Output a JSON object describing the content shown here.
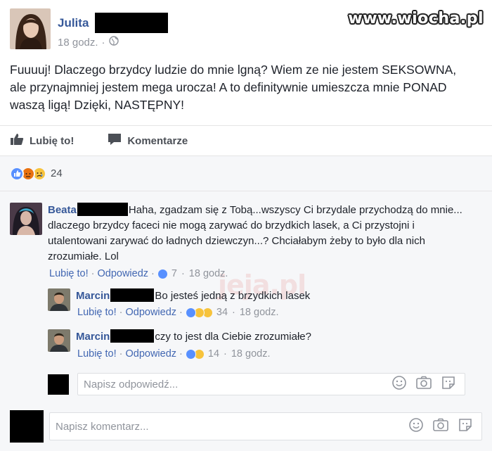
{
  "watermark": "www.wiocha.pl",
  "ghost_watermark": "jeja.pl",
  "post": {
    "author_name": "Julita",
    "time": "18 godz.",
    "separator": "·",
    "privacy_icon": "globe-icon",
    "text": "Fuuuuj! Dlaczego brzydcy ludzie do mnie lgną? Wiem ze nie jestem SEKSOWNA, ale przynajmniej jestem mega urocza! A to definitywnie umieszcza mnie PONAD waszą ligą! Dzięki, NASTĘPNY!"
  },
  "actions": {
    "like_label": "Lubię to!",
    "comment_label": "Komentarze"
  },
  "reactions": {
    "icons": [
      "like-reaction-icon",
      "angry-reaction-icon",
      "sad-reaction-icon"
    ],
    "count": "24"
  },
  "comments": [
    {
      "author": "Beata",
      "text": "Haha, zgadzam się z Tobą...wszyscy Ci brzydale przychodzą do mnie... dlaczego brzydcy faceci nie mogą zarywać do brzydkich lasek, a Ci przystojni i utalentowani zarywać do ładnych dziewczyn...? Chciałabym żeby to było dla nich zrozumiałe. Lol",
      "like": "Lubię to!",
      "reply": "Odpowiedz",
      "reaction_count": "7",
      "time": "18 godz."
    }
  ],
  "replies": [
    {
      "author": "Marcin",
      "text": "Bo jesteś jedną z brzydkich lasek",
      "like": "Lubię to!",
      "reply": "Odpowiedz",
      "reaction_count": "34",
      "time": "18 godz."
    },
    {
      "author": "Marcin",
      "text": "czy to jest dla Ciebie zrozumiałe?",
      "like": "Lubię to!",
      "reply": "Odpowiedz",
      "reaction_count": "14",
      "time": "18 godz."
    }
  ],
  "reply_input": {
    "placeholder": "Napisz odpowiedź..."
  },
  "comment_input": {
    "placeholder": "Napisz komentarz..."
  },
  "colors": {
    "link_blue": "#365899",
    "like_blue": "#4267b2",
    "muted": "#90949c",
    "panel_bg": "#f6f7f9"
  }
}
